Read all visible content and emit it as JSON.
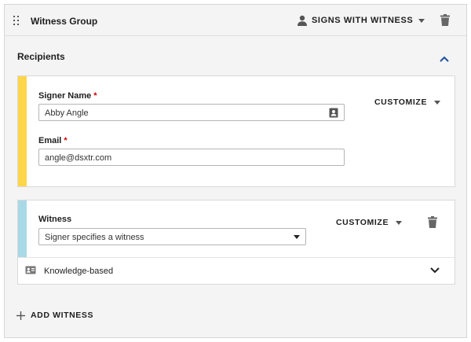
{
  "group": {
    "title": "Witness Group",
    "signs_with_label": "SIGNS WITH WITNESS"
  },
  "recipients": {
    "title": "Recipients"
  },
  "signer": {
    "accent_color": "#ffd64a",
    "name_label": "Signer Name",
    "name_value": "Abby Angle",
    "email_label": "Email",
    "email_value": "angle@dsxtr.com",
    "required_mark": "*",
    "customize_label": "CUSTOMIZE"
  },
  "witness": {
    "accent_color": "#a9d9e7",
    "label": "Witness",
    "select_value": "Signer specifies a witness",
    "customize_label": "CUSTOMIZE",
    "auth_label": "Knowledge-based"
  },
  "actions": {
    "add_witness_label": "ADD WITNESS"
  },
  "icons": {
    "drag": "drag-handle-icon",
    "person": "person-icon",
    "trash": "trash-icon",
    "collapse": "chevron-up-icon",
    "contacts": "contact-card-icon",
    "id_card": "id-card-icon",
    "expand": "chevron-down-icon",
    "add": "plus-icon"
  }
}
